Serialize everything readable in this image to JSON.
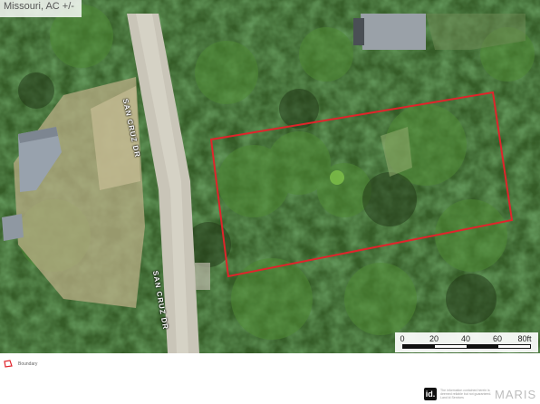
{
  "map": {
    "title": "Missouri,  AC +/-",
    "streets": [
      {
        "name": "SAN CRUZ DR",
        "id": "upper"
      },
      {
        "name": "SAN CRUZ DR",
        "id": "lower"
      }
    ],
    "boundary_color": "#e0242b",
    "imagery": "satellite"
  },
  "scale_bar": {
    "ticks": [
      "0",
      "20",
      "40",
      "60",
      "80ft"
    ]
  },
  "legend": {
    "label": "Boundary",
    "icon": "boundary-polygon-icon"
  },
  "footer": {
    "logo": "id.",
    "disclaimer": "The information contained herein is deemed reliable but not guaranteed. Land id Services",
    "brand": "MARIS"
  }
}
